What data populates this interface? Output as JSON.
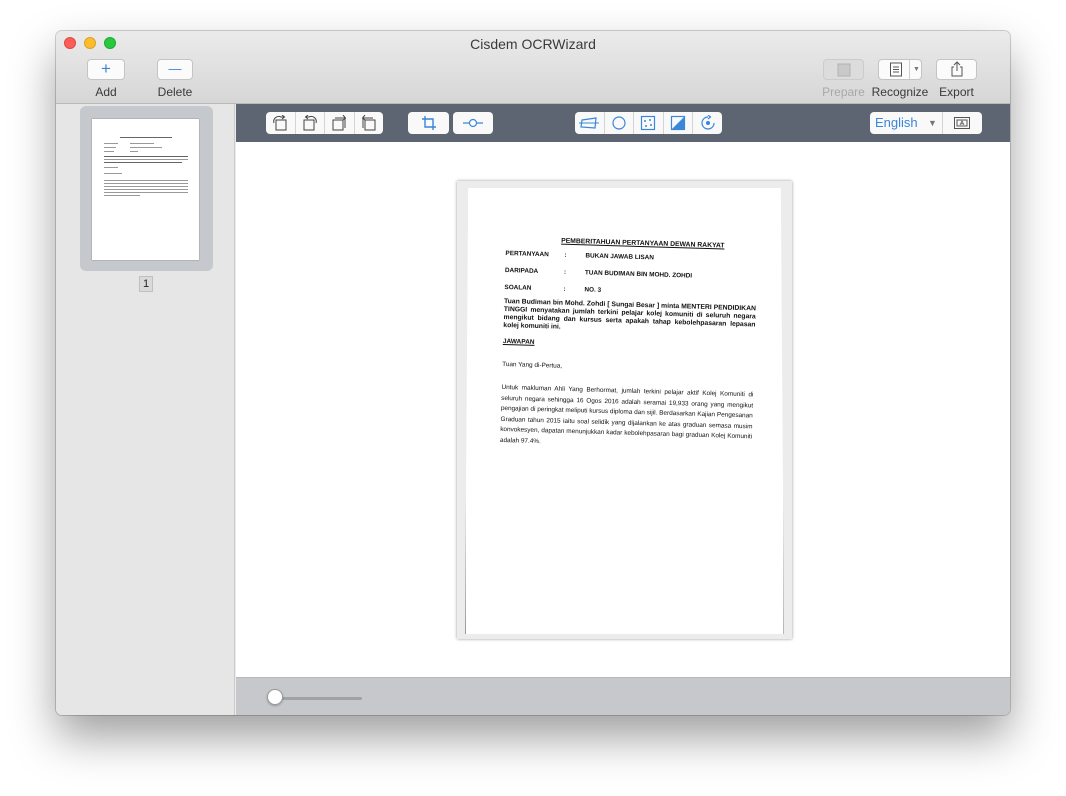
{
  "window": {
    "title": "Cisdem OCRWizard"
  },
  "toolbar": {
    "add_label": "Add",
    "add_glyph": "+",
    "delete_label": "Delete",
    "delete_glyph": "—",
    "prepare_label": "Prepare",
    "recognize_label": "Recognize",
    "export_label": "Export"
  },
  "sidebar": {
    "pages": [
      {
        "number": "1",
        "selected": true
      }
    ]
  },
  "edit_toolbar": {
    "rotate_tools": [
      "rotate-left-icon",
      "rotate-right-icon",
      "flip-left-icon",
      "flip-right-icon"
    ],
    "crop_tools": [
      "crop-icon"
    ],
    "slider_tools": [
      "adjust-slider-icon"
    ],
    "image_tools": [
      "deskew-icon",
      "circle-icon",
      "denoise-icon",
      "contrast-icon",
      "reset-rotate-icon"
    ],
    "language": "English",
    "language_options_visible": [
      "English"
    ],
    "text_area_tool": "text-area-icon"
  },
  "document": {
    "title": "PEMBERITAHUAN PERTANYAAN DEWAN RAKYAT",
    "fields": [
      {
        "label": "PERTANYAAN",
        "colon": ":",
        "value": "BUKAN JAWAB LISAN"
      },
      {
        "label": "DARIPADA",
        "colon": ":",
        "value": "TUAN BUDIMAN BIN MOHD. ZOHDI"
      },
      {
        "label": "SOALAN",
        "colon": ":",
        "value": "NO. 3"
      }
    ],
    "question": "Tuan Budiman bin Mohd. Zohdi [ Sungai Besar ] minta MENTERI PENDIDIKAN TINGGI menyatakan jumlah terkini pelajar kolej komuniti di seluruh negara mengikut bidang dan kursus serta apakah tahap kebolehpasaran lepasan kolej komuniti ini.",
    "answer_heading": "JAWAPAN",
    "greeting": "Tuan Yang di-Pertua,",
    "answer": "Untuk makluman Ahli Yang Berhormat, jumlah terkini pelajar aktif Kolej Komuniti di seluruh negara sehingga 16 Ogos 2016 adalah seramai 19,933 orang yang mengikut pengajian di peringkat meliputi kursus diploma dan sijil. Berdasarkan Kajian Pengesanan Graduan tahun 2015 iaitu soal selidik yang dijalankan ke atas graduan semasa musim konvokesyen, dapatan menunjukkan kadar kebolehpasaran bagi graduan Kolej Komuniti adalah 97.4%."
  },
  "zoom": {
    "level_fraction": 0.0
  },
  "colors": {
    "accent": "#3a86d8",
    "edit_toolbar_bg": "#5d6573",
    "bottombar_bg": "#c6c8cc",
    "sidebar_selection": "#c5c8cd"
  }
}
